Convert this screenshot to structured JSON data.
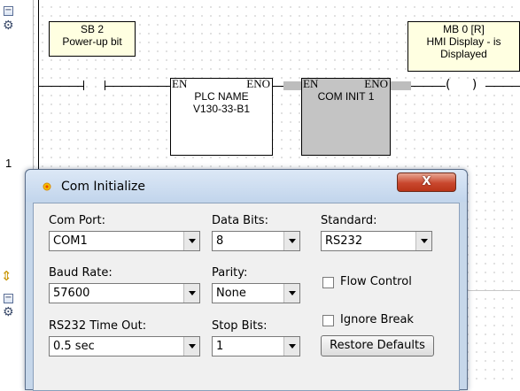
{
  "ladder": {
    "rung_number": "1",
    "contact_comment": [
      "SB 2",
      "Power-up bit"
    ],
    "coil_comment": [
      "MB 0 [R]",
      "HMI Display - is",
      "Displayed"
    ],
    "fb_plc_name": {
      "en": "EN",
      "eno": "ENO",
      "line1": "PLC NAME",
      "line2": "V130-33-B1"
    },
    "fb_com_init": {
      "en": "EN",
      "eno": "ENO",
      "line1": "COM INIT 1"
    },
    "coil_symbol": "( )",
    "icons": [
      "collapse-icon",
      "rung-edit-icon",
      "expand-arrows-icon"
    ]
  },
  "dialog": {
    "title": "Com Initialize",
    "close_label": "X",
    "com_port": {
      "label": "Com Port:",
      "value": "COM1"
    },
    "data_bits": {
      "label": "Data Bits:",
      "value": "8"
    },
    "standard": {
      "label": "Standard:",
      "value": "RS232"
    },
    "baud_rate": {
      "label": "Baud Rate:",
      "value": "57600"
    },
    "parity": {
      "label": "Parity:",
      "value": "None"
    },
    "flow_control": {
      "label": "Flow Control",
      "checked": false
    },
    "ignore_break": {
      "label": "Ignore Break",
      "checked": false
    },
    "timeout": {
      "label": "RS232 Time Out:",
      "value": "0.5 sec"
    },
    "stop_bits": {
      "label": "Stop Bits:",
      "value": "1"
    },
    "restore_label": "Restore Defaults"
  },
  "colors": {
    "comment_bg": "#ffffe1",
    "selected_block": "#c0c0c0",
    "close_red": "#c9472e"
  }
}
